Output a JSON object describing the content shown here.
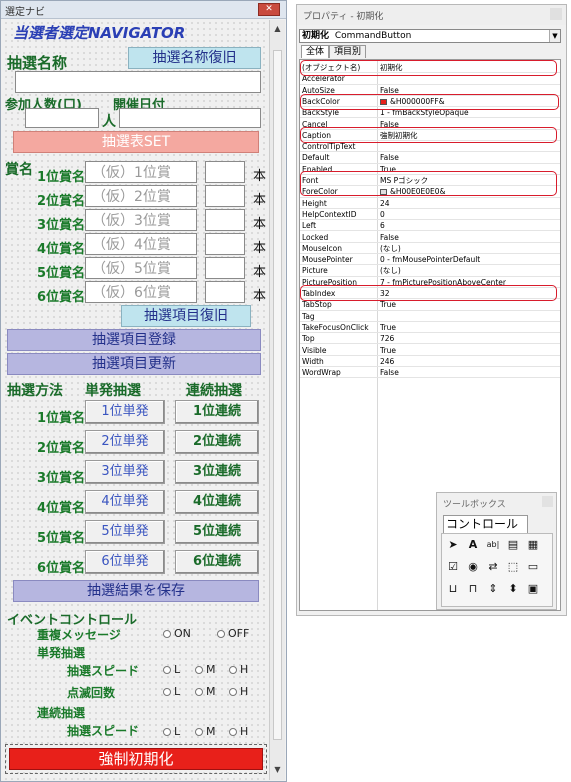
{
  "form": {
    "window_title": "選定ナビ",
    "app_title": "当選者選定NAVIGATOR",
    "lottery_name_label": "抽選名称",
    "lottery_name_restore": "抽選名称復旧",
    "participants_label": "参加人数(口)",
    "people_unit": "人",
    "date_label": "開催日付",
    "set_table_button": "抽選表SET",
    "prize_label": "賞名",
    "prizes": [
      {
        "label": "1位賞名",
        "placeholder": "（仮）1位賞"
      },
      {
        "label": "2位賞名",
        "placeholder": "（仮）2位賞"
      },
      {
        "label": "3位賞名",
        "placeholder": "（仮）3位賞"
      },
      {
        "label": "4位賞名",
        "placeholder": "（仮）4位賞"
      },
      {
        "label": "5位賞名",
        "placeholder": "（仮）5位賞"
      },
      {
        "label": "6位賞名",
        "placeholder": "（仮）6位賞"
      }
    ],
    "count_unit": "本",
    "restore_items_button": "抽選項目復旧",
    "register_items_button": "抽選項目登録",
    "update_items_button": "抽選項目更新",
    "method_label": "抽選方法",
    "single_label": "単発抽選",
    "continuous_label": "連続抽選",
    "draw_rows": [
      {
        "label": "1位賞名",
        "single": "1位単発",
        "continuous": "1位連続"
      },
      {
        "label": "2位賞名",
        "single": "2位単発",
        "continuous": "2位連続"
      },
      {
        "label": "3位賞名",
        "single": "3位単発",
        "continuous": "3位連続"
      },
      {
        "label": "4位賞名",
        "single": "4位単発",
        "continuous": "4位連続"
      },
      {
        "label": "5位賞名",
        "single": "5位単発",
        "continuous": "5位連続"
      },
      {
        "label": "6位賞名",
        "single": "6位単発",
        "continuous": "6位連続"
      }
    ],
    "save_results_button": "抽選結果を保存",
    "event_control_label": "イベントコントロール",
    "duplicate_message_label": "重複メッセージ",
    "on_label": "ON",
    "off_label": "OFF",
    "single_draw_label": "単発抽選",
    "draw_speed_label": "抽選スピード",
    "blink_count_label": "点滅回数",
    "continuous_draw_label": "連続抽選",
    "draw_speed_label_2": "抽選スピード",
    "l_label": "L",
    "m_label": "M",
    "h_label": "H",
    "force_reset_button": "強制初期化"
  },
  "properties": {
    "title": "プロパティ - 初期化",
    "object_name": "初期化",
    "object_type": "CommandButton",
    "tab_all": "全体",
    "tab_category": "項目別",
    "rows": [
      {
        "name": "(オブジェクト名)",
        "value": "初期化"
      },
      {
        "name": "Accelerator",
        "value": ""
      },
      {
        "name": "AutoSize",
        "value": "False"
      },
      {
        "name": "BackColor",
        "value": "&H000000FF&"
      },
      {
        "name": "BackStyle",
        "value": "1 - fmBackStyleOpaque"
      },
      {
        "name": "Cancel",
        "value": "False"
      },
      {
        "name": "Caption",
        "value": "強制初期化"
      },
      {
        "name": "ControlTipText",
        "value": ""
      },
      {
        "name": "Default",
        "value": "False"
      },
      {
        "name": "Enabled",
        "value": "True"
      },
      {
        "name": "Font",
        "value": "MS Pゴシック"
      },
      {
        "name": "ForeColor",
        "value": "&H00E0E0E0&"
      },
      {
        "name": "Height",
        "value": "24"
      },
      {
        "name": "HelpContextID",
        "value": "0"
      },
      {
        "name": "Left",
        "value": "6"
      },
      {
        "name": "Locked",
        "value": "False"
      },
      {
        "name": "MouseIcon",
        "value": "(なし)"
      },
      {
        "name": "MousePointer",
        "value": "0 - fmMousePointerDefault"
      },
      {
        "name": "Picture",
        "value": "(なし)"
      },
      {
        "name": "PicturePosition",
        "value": "7 - fmPicturePositionAboveCenter"
      },
      {
        "name": "TabIndex",
        "value": "32"
      },
      {
        "name": "TabStop",
        "value": "True"
      },
      {
        "name": "Tag",
        "value": ""
      },
      {
        "name": "TakeFocusOnClick",
        "value": "True"
      },
      {
        "name": "Top",
        "value": "726"
      },
      {
        "name": "Visible",
        "value": "True"
      },
      {
        "name": "Width",
        "value": "246"
      },
      {
        "name": "WordWrap",
        "value": "False"
      }
    ],
    "backcolor_swatch": "#e8201a",
    "forecolor_swatch": "#e0e0e0"
  },
  "toolbox": {
    "title": "ツールボックス",
    "tab_label": "コントロール",
    "tools": [
      "pointer-icon",
      "label-icon",
      "textbox-icon",
      "combobox-icon",
      "listbox-icon",
      "checkbox-icon",
      "optionbutton-icon",
      "togglebutton-icon",
      "frame-icon",
      "commandbutton-icon",
      "tabstrip-icon",
      "multipage-icon",
      "scrollbar-icon",
      "spinbutton-icon",
      "image-icon"
    ]
  }
}
